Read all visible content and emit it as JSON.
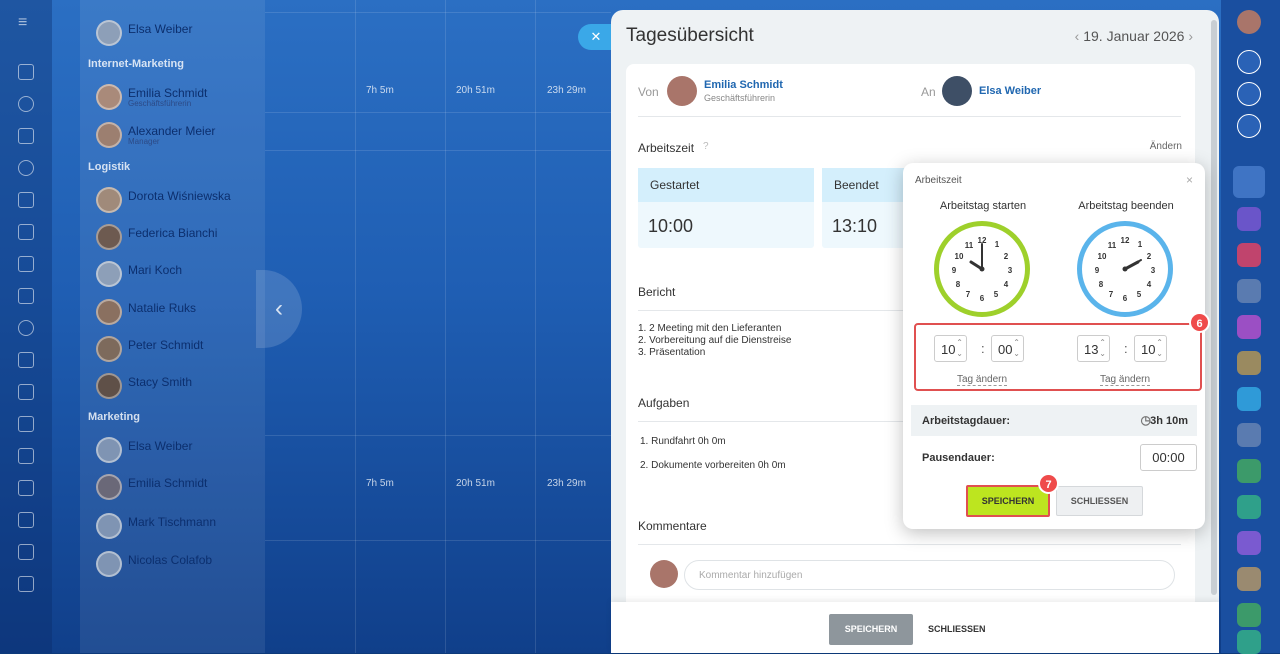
{
  "group_labels": [
    "Internet-Marketing",
    "Logistik",
    "Marketing"
  ],
  "people": [
    {
      "name": "Elsa Weiber",
      "role": ""
    },
    {
      "name": "Emilia Schmidt",
      "role": "Geschäftsführerin"
    },
    {
      "name": "Alexander Meier",
      "role": "Manager"
    },
    {
      "name": "Dorota Wiśniewska",
      "role": ""
    },
    {
      "name": "Federica Bianchi",
      "role": ""
    },
    {
      "name": "Mari Koch",
      "role": ""
    },
    {
      "name": "Natalie Ruks",
      "role": ""
    },
    {
      "name": "Peter Schmidt",
      "role": ""
    },
    {
      "name": "Stacy Smith",
      "role": ""
    },
    {
      "name": "Elsa Weiber",
      "role": ""
    },
    {
      "name": "Emilia Schmidt",
      "role": ""
    },
    {
      "name": "Mark Tischmann",
      "role": ""
    },
    {
      "name": "Nicolas Colafob",
      "role": ""
    }
  ],
  "grid_cells": [
    "7h 5m",
    "20h 51m",
    "23h 29m",
    "7h 5m",
    "20h 51m",
    "23h 29m"
  ],
  "panel": {
    "title": "Tagesübersicht",
    "date": "19. Januar 2026",
    "from_label": "Von",
    "from_name": "Emilia Schmidt",
    "from_role": "Geschäftsführerin",
    "to_label": "An",
    "to_name": "Elsa Weiber",
    "worktime_label": "Arbeitszeit",
    "change_label": "Ändern",
    "started_label": "Gestartet",
    "started_value": "10:00",
    "ended_label": "Beendet",
    "ended_value": "13:10",
    "report_label": "Bericht",
    "report_lines": [
      "1. 2 Meeting mit den Lieferanten",
      "2. Vorbereitung auf die Dienstreise",
      "3. Präsentation"
    ],
    "tasks_label": "Aufgaben",
    "tasks": [
      "1. Rundfahrt 0h 0m",
      "2. Dokumente vorbereiten 0h 0m"
    ],
    "comments_label": "Kommentare",
    "comment_placeholder": "Kommentar hinzufügen",
    "save_label": "SPEICHERN",
    "close_label": "SCHLIESSEN"
  },
  "popup": {
    "title": "Arbeitszeit",
    "start_label": "Arbeitstag starten",
    "end_label": "Arbeitstag beenden",
    "start_h": "10",
    "start_m": "00",
    "end_h": "13",
    "end_m": "10",
    "change_day": "Tag ändern",
    "duration_label": "Arbeitstagdauer:",
    "duration_value": "3h 10m",
    "pause_label": "Pausendauer:",
    "pause_value": "00:00",
    "save_label": "SPEICHERN",
    "close_label": "SCHLIESSEN",
    "step6": "6",
    "step7": "7"
  },
  "clock_numbers": [
    "12",
    "1",
    "2",
    "3",
    "4",
    "5",
    "6",
    "7",
    "8",
    "9",
    "10",
    "11"
  ],
  "colors": {
    "accent_green": "#bde51f",
    "accent_blue": "#2067b0",
    "highlight": "#e05050",
    "step_badge": "#ef4b4b"
  }
}
